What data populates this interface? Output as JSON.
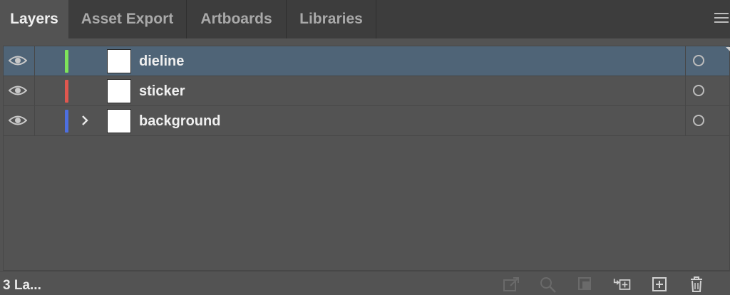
{
  "tabs": [
    {
      "label": "Layers",
      "active": true
    },
    {
      "label": "Asset Export",
      "active": false
    },
    {
      "label": "Artboards",
      "active": false
    },
    {
      "label": "Libraries",
      "active": false
    }
  ],
  "panel_menu_icon": "hamburger-menu-icon",
  "layers": [
    {
      "name": "dieline",
      "color": "#7ee35a",
      "selected": true,
      "expandable": false
    },
    {
      "name": "sticker",
      "color": "#e0574f",
      "selected": false,
      "expandable": false
    },
    {
      "name": "background",
      "color": "#4d6fe0",
      "selected": false,
      "expandable": true
    }
  ],
  "status": {
    "layer_count": "3 La...",
    "icons": [
      "collect-for-export-icon",
      "locate-object-icon",
      "make-clipping-mask-icon",
      "create-sublayer-icon",
      "create-new-layer-icon",
      "delete-icon"
    ]
  },
  "colors": {
    "panel_bg": "#535353",
    "tabbar_bg": "#3d3d3d",
    "selection": "#4f6477"
  }
}
